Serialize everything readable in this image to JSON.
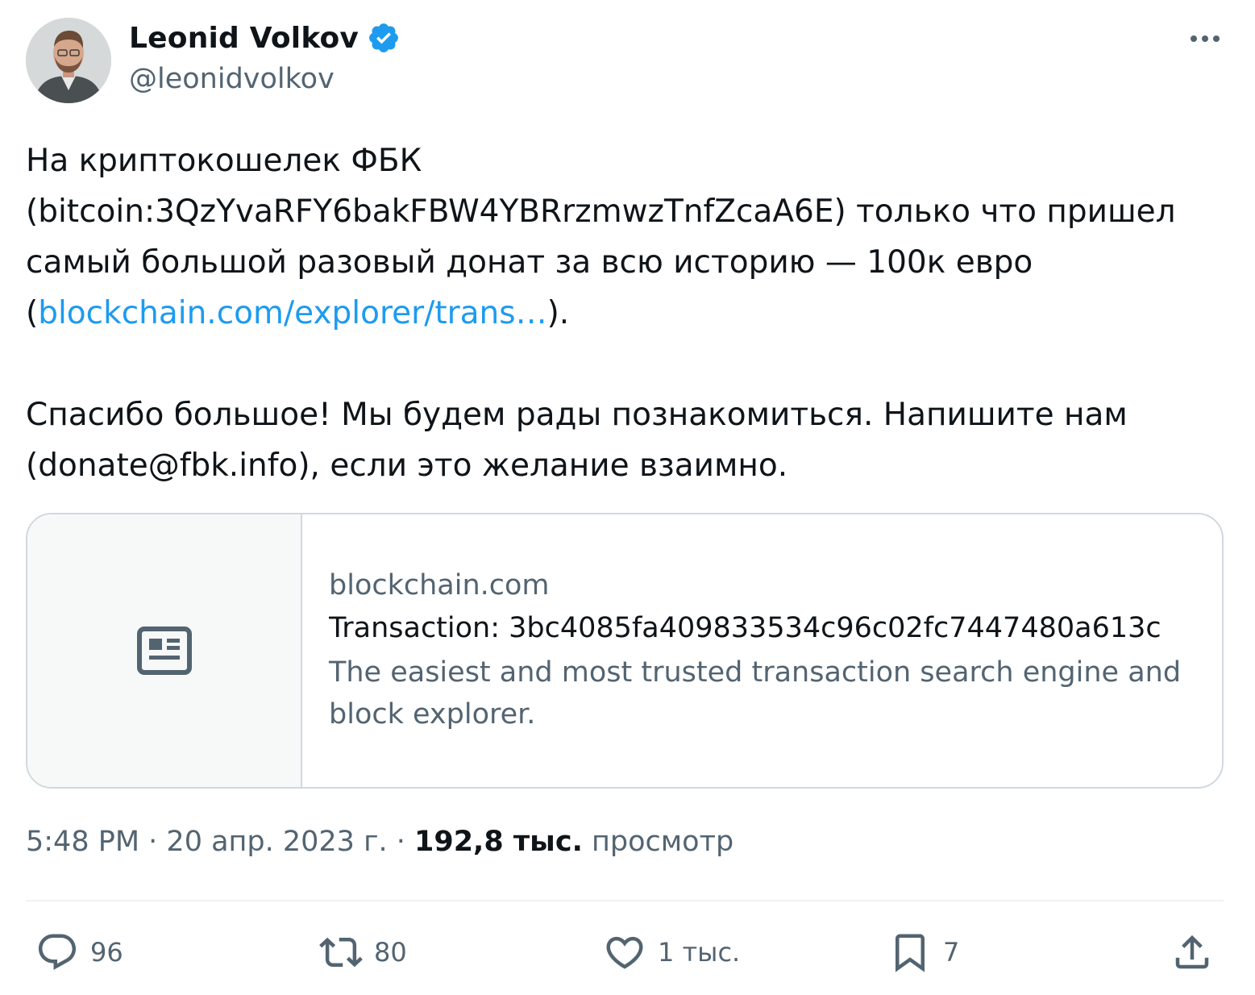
{
  "author": {
    "display_name": "Leonid Volkov",
    "handle": "@leonidvolkov",
    "verified": true
  },
  "tweet": {
    "text_part1": "На криптокошелек ФБК\n(bitcoin:3QzYvaRFY6bakFBW4YBRrzmwzTnfZcaA6E) только что пришел самый большой разовый донат за всю историю — 100к евро\n(",
    "link_text": "blockchain.com/explorer/trans…",
    "text_part2": ").\n\nСпасибо большое! Мы будем рады познакомиться. Напишите нам (donate@fbk.info), если это желание взаимно."
  },
  "link_card": {
    "domain": "blockchain.com",
    "title": "Transaction: 3bc4085fa409833534c96c02fc7447480a613c",
    "description": "The easiest and most trusted transaction search engine and block explorer."
  },
  "meta": {
    "time": "5:48 PM",
    "separator": " · ",
    "date": "20 апр. 2023 г.",
    "views_count": "192,8 тыс.",
    "views_label": "просмотр"
  },
  "actions": {
    "replies": "96",
    "reposts": "80",
    "likes": "1 тыс.",
    "bookmarks": "7"
  },
  "colors": {
    "link": "#1d9bf0",
    "secondary_text": "#536471",
    "primary_text": "#0f1419",
    "verified_badge": "#1d9bf0",
    "border": "#cfd9de"
  },
  "icons": [
    "verified-badge-icon",
    "more-icon",
    "article-icon",
    "reply-icon",
    "repost-icon",
    "like-icon",
    "bookmark-icon",
    "share-icon"
  ]
}
